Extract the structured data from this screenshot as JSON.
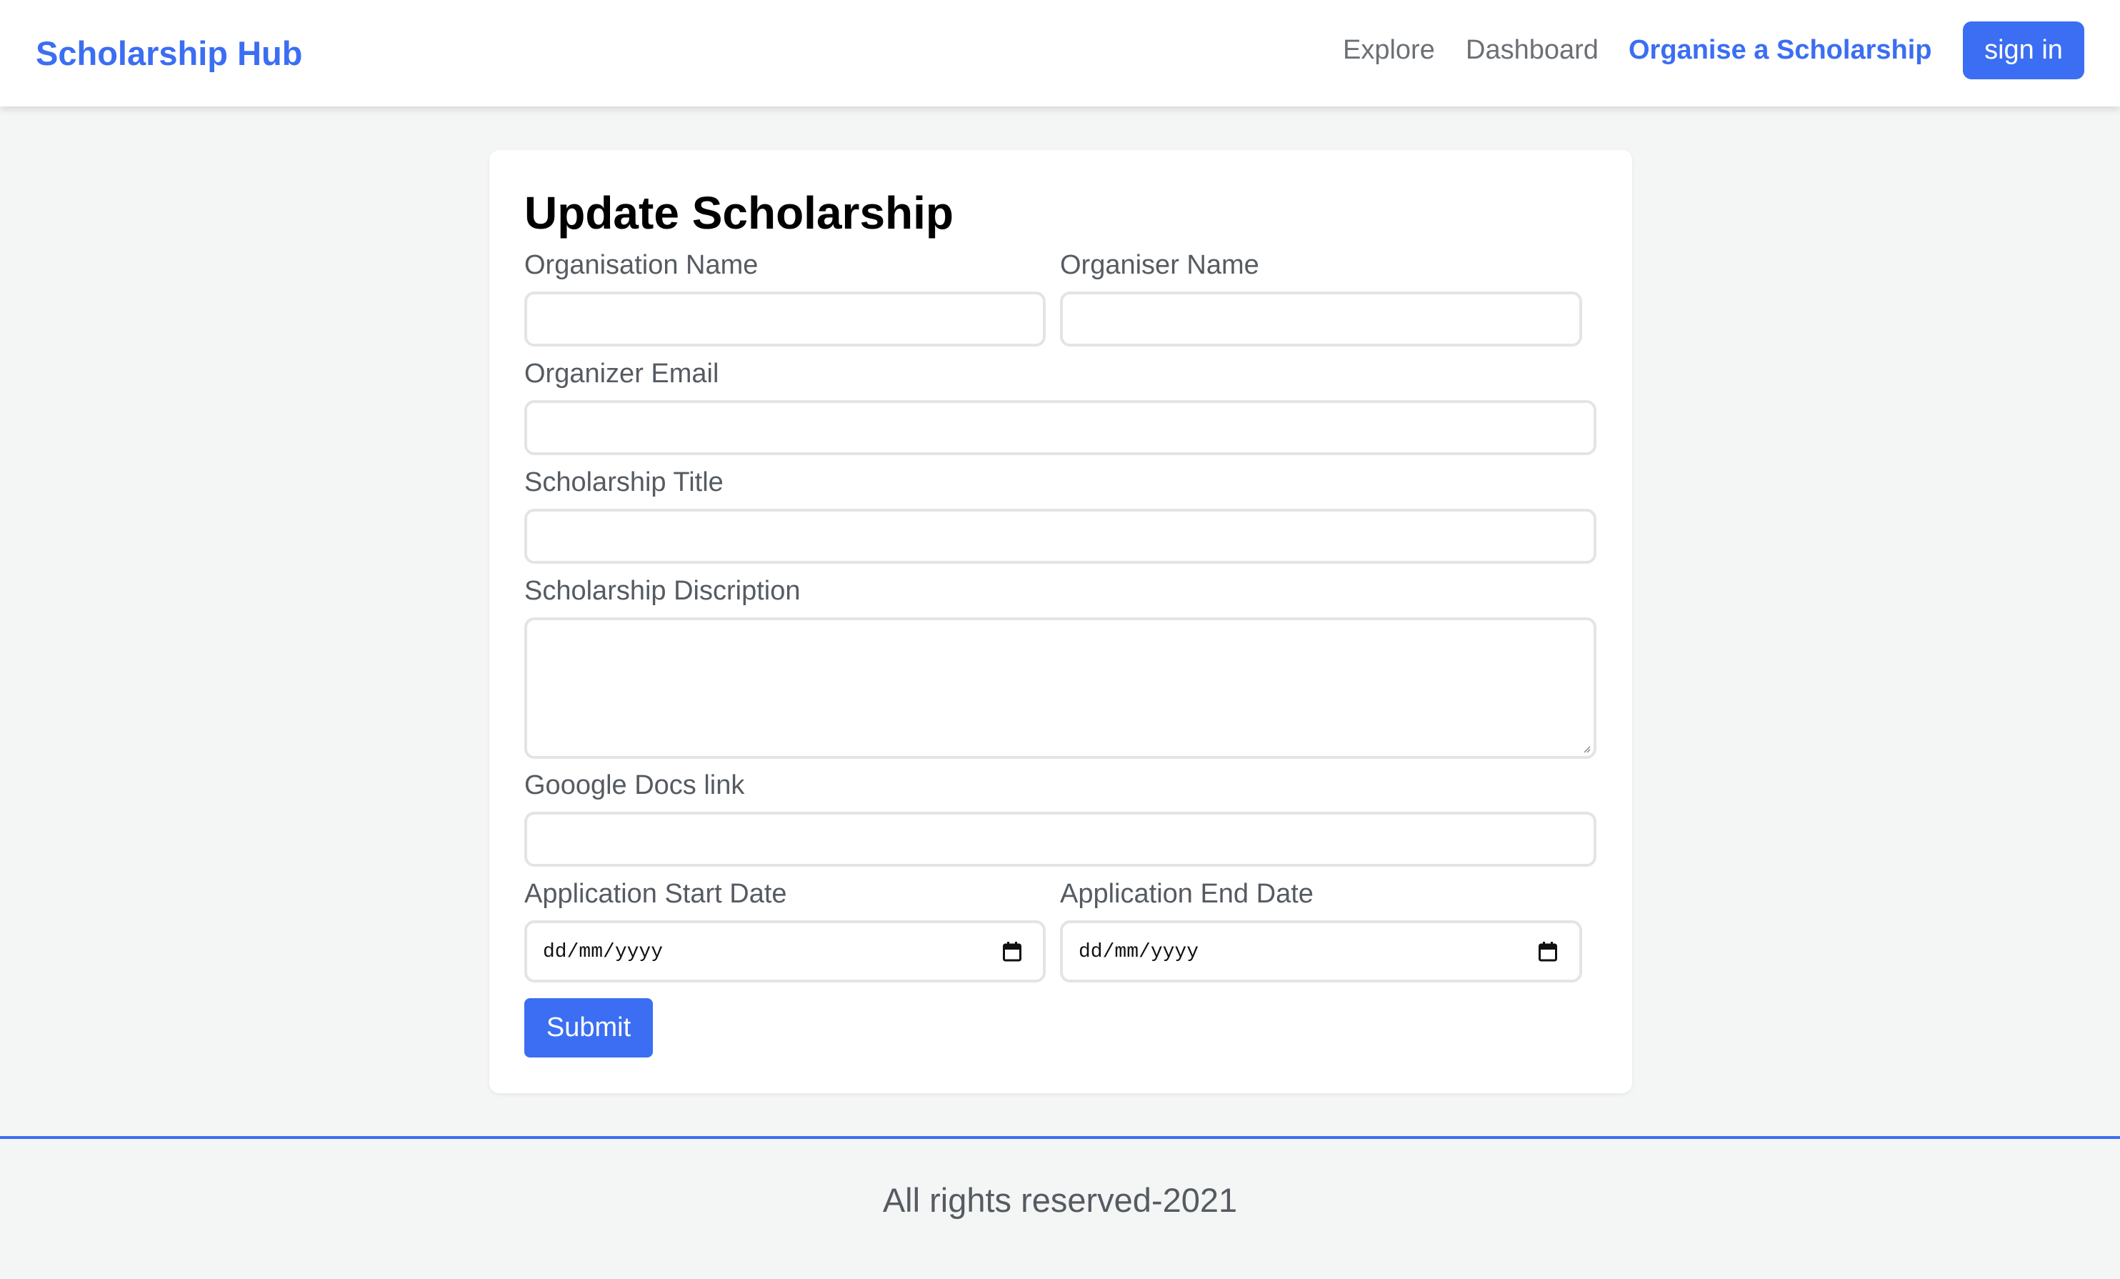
{
  "navbar": {
    "brand": "Scholarship Hub",
    "links": [
      "Explore",
      "Dashboard",
      "Organise a Scholarship"
    ],
    "signin_label": "sign in"
  },
  "form": {
    "title": "Update Scholarship",
    "fields": {
      "organisation_name": {
        "label": "Organisation Name",
        "value": ""
      },
      "organiser_name": {
        "label": "Organiser Name",
        "value": ""
      },
      "organizer_email": {
        "label": "Organizer Email",
        "value": ""
      },
      "scholarship_title": {
        "label": "Scholarship Title",
        "value": ""
      },
      "scholarship_description": {
        "label": "Scholarship Discription",
        "value": ""
      },
      "google_docs_link": {
        "label": "Gooogle Docs link",
        "value": ""
      },
      "start_date": {
        "label": "Application Start Date",
        "placeholder": "dd/mm/yyyy"
      },
      "end_date": {
        "label": "Application End Date",
        "placeholder": "dd/mm/yyyy"
      }
    },
    "submit_label": "Submit"
  },
  "footer": {
    "text": "All rights reserved-2021"
  },
  "colors": {
    "accent": "#3b6ef2",
    "background": "#f4f5f5",
    "label": "#555b61"
  }
}
